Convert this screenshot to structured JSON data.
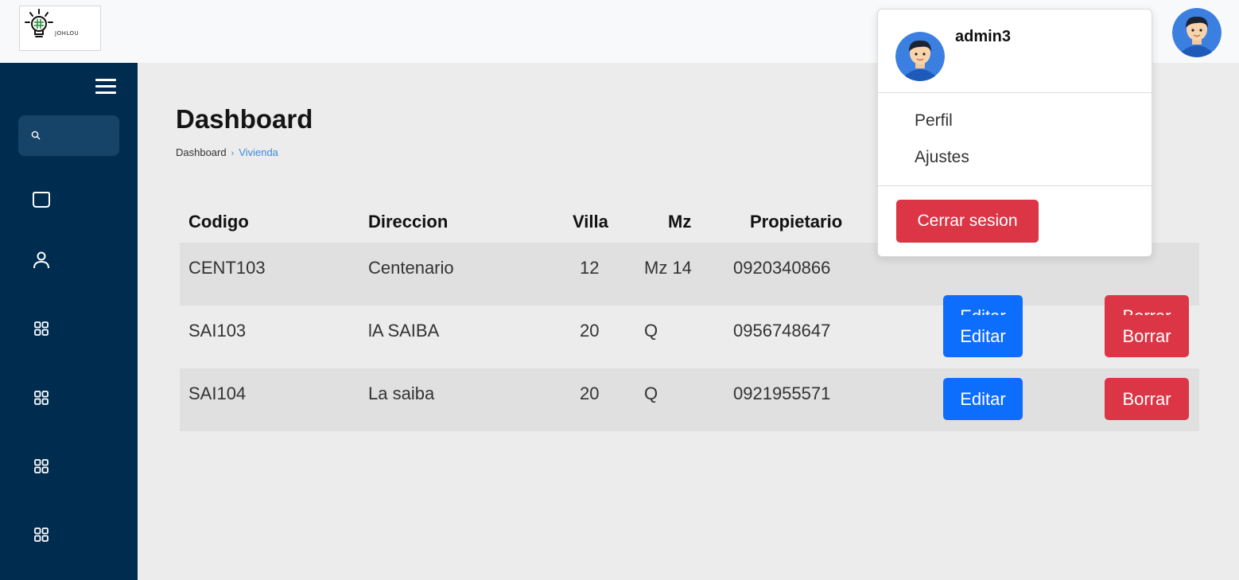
{
  "brand": {
    "logo_text": "JOHLOU"
  },
  "sidebar": {
    "search_icon": "search-icon",
    "items": [
      {
        "icon": "square-rounded-icon"
      },
      {
        "icon": "user-icon"
      },
      {
        "icon": "grid-icon"
      },
      {
        "icon": "grid-icon"
      },
      {
        "icon": "grid-icon"
      },
      {
        "icon": "grid-icon"
      }
    ]
  },
  "main": {
    "title": "Dashboard",
    "breadcrumb": {
      "root": "Dashboard",
      "separator": "›",
      "current": "Vivienda"
    }
  },
  "table": {
    "headers": {
      "codigo": "Codigo",
      "direccion": "Direccion",
      "villa": "Villa",
      "mz": "Mz",
      "propietario": "Propietario"
    },
    "rows": [
      {
        "codigo": "CENT103",
        "direccion": "Centenario",
        "villa": "12",
        "mz": "Mz 14",
        "propietario": "0920340866",
        "edit": "Editar",
        "delete": "Borrar"
      },
      {
        "codigo": "SAI103",
        "direccion": "lA SAIBA",
        "villa": "20",
        "mz": "Q",
        "propietario": "0956748647",
        "edit": "Editar",
        "delete": "Borrar"
      },
      {
        "codigo": "SAI104",
        "direccion": "La saiba",
        "villa": "20",
        "mz": "Q",
        "propietario": "0921955571",
        "edit": "Editar",
        "delete": "Borrar"
      }
    ]
  },
  "user_menu": {
    "username": "admin3",
    "items": [
      "Perfil",
      "Ajustes"
    ],
    "logout": "Cerrar sesion"
  },
  "colors": {
    "sidebar": "#002c4f",
    "primary": "#0d6efd",
    "danger": "#dc3545",
    "accent": "#3a8be0"
  }
}
